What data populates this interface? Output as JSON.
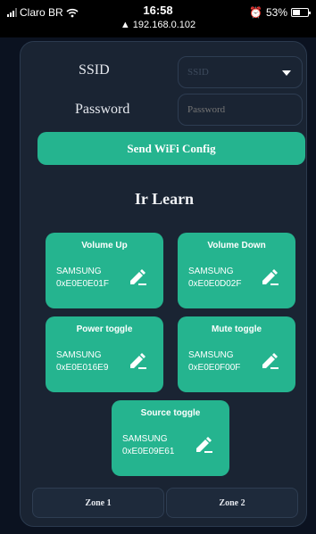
{
  "status": {
    "carrier": "Claro BR",
    "time": "16:58",
    "url": "192.168.0.102",
    "battery": "53%",
    "battery_level": 0.53
  },
  "wifi": {
    "ssid_label": "SSID",
    "ssid_placeholder": "SSID",
    "password_label": "Password",
    "password_placeholder": "Password",
    "send_label": "Send WiFi Config"
  },
  "section_title": "Ir Learn",
  "cards": [
    {
      "title": "Volume Up",
      "brand": "SAMSUNG",
      "code": "0xE0E0E01F"
    },
    {
      "title": "Volume Down",
      "brand": "SAMSUNG",
      "code": "0xE0E0D02F"
    },
    {
      "title": "Power toggle",
      "brand": "SAMSUNG",
      "code": "0xE0E016E9"
    },
    {
      "title": "Mute toggle",
      "brand": "SAMSUNG",
      "code": "0xE0E0F00F"
    },
    {
      "title": "Source toggle",
      "brand": "SAMSUNG",
      "code": "0xE0E09E61"
    }
  ],
  "zones": [
    {
      "label": "Zone 1"
    },
    {
      "label": "Zone 2"
    }
  ],
  "colors": {
    "accent": "#25b48f",
    "panel": "#1a2433",
    "background": "#0b1220"
  },
  "icons": {
    "edit": "pencil-icon"
  }
}
